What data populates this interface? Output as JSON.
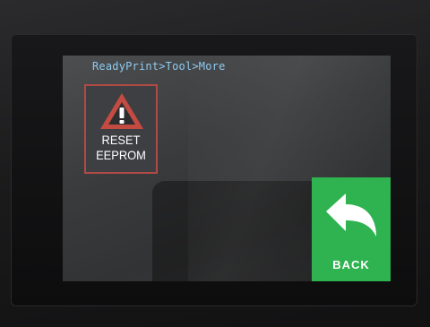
{
  "screen": {
    "breadcrumb": "ReadyPrint>Tool>More"
  },
  "buttons": {
    "reset_eeprom": {
      "label": "RESET\nEEPROM",
      "icon": "warning-icon"
    },
    "back": {
      "label": "BACK",
      "icon": "back-arrow-icon"
    }
  },
  "colors": {
    "screen_background": "#3a3b3d",
    "breadcrumb_text": "#8ecbf0",
    "reset_border": "#b04a45",
    "warning_fill": "#c44b42",
    "back_background": "#2fb250"
  }
}
